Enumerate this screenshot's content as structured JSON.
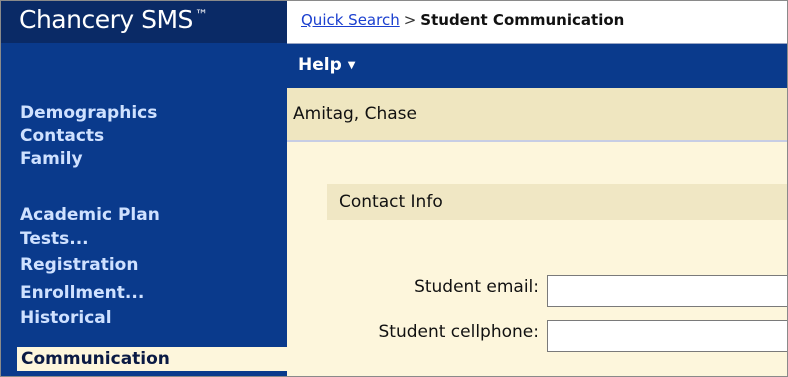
{
  "brand": {
    "name": "Chancery SMS",
    "trademark": "™"
  },
  "breadcrumb": {
    "link": "Quick Search",
    "separator": ">",
    "current": "Student Communication"
  },
  "menu": {
    "help_label": "Help",
    "help_caret": "▼"
  },
  "sidebar": {
    "items": [
      {
        "label": "Demographics"
      },
      {
        "label": "Contacts"
      },
      {
        "label": "Family"
      },
      {
        "label": "Academic Plan"
      },
      {
        "label": "Tests..."
      },
      {
        "label": "Registration"
      },
      {
        "label": "Enrollment..."
      },
      {
        "label": "Historical"
      }
    ],
    "active_label": "Communication"
  },
  "student": {
    "name": "Amitag, Chase"
  },
  "contact_info": {
    "section_title": "Contact Info",
    "email_label": "Student email:",
    "email_value": "",
    "cellphone_label": "Student cellphone:",
    "cellphone_value": ""
  },
  "colors": {
    "nav_blue": "#0a3a8c",
    "brand_blue": "#0a2a66",
    "cream": "#fdf6dc",
    "link_blue": "#1a3fcf"
  }
}
